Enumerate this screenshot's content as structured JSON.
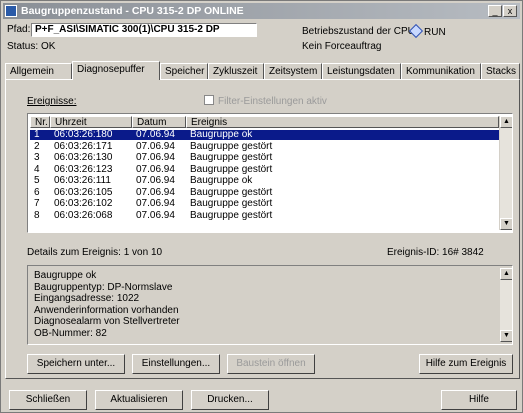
{
  "window": {
    "title": "Baugruppenzustand - CPU 315-2 DP  ONLINE",
    "min": "_",
    "close": "x"
  },
  "info": {
    "path_label": "Pfad:",
    "path_value": "P+F_ASI\\SIMATIC 300(1)\\CPU 315-2 DP",
    "status_label": "Status:",
    "status_value": "OK",
    "cpu_state_label": "Betriebszustand der CPU:",
    "cpu_state_value": "RUN",
    "force_status": "Kein Forceauftrag"
  },
  "tabs": [
    "Allgemein",
    "Diagnosepuffer",
    "Speicher",
    "Zykluszeit",
    "Zeitsystem",
    "Leistungsdaten",
    "Kommunikation",
    "Stacks"
  ],
  "events": {
    "label": "Ereignisse:",
    "filter_label": "Filter-Einstellungen aktiv",
    "columns": [
      "Nr.",
      "Uhrzeit",
      "Datum",
      "Ereignis"
    ],
    "rows": [
      {
        "nr": "1",
        "time": "06:03:26:180",
        "date": "07.06.94",
        "event": "Baugruppe ok"
      },
      {
        "nr": "2",
        "time": "06:03:26:171",
        "date": "07.06.94",
        "event": "Baugruppe gestört"
      },
      {
        "nr": "3",
        "time": "06:03:26:130",
        "date": "07.06.94",
        "event": "Baugruppe gestört"
      },
      {
        "nr": "4",
        "time": "06:03:26:123",
        "date": "07.06.94",
        "event": "Baugruppe gestört"
      },
      {
        "nr": "5",
        "time": "06:03:26:111",
        "date": "07.06.94",
        "event": "Baugruppe ok"
      },
      {
        "nr": "6",
        "time": "06:03:26:105",
        "date": "07.06.94",
        "event": "Baugruppe gestört"
      },
      {
        "nr": "7",
        "time": "06:03:26:102",
        "date": "07.06.94",
        "event": "Baugruppe gestört"
      },
      {
        "nr": "8",
        "time": "06:03:26:068",
        "date": "07.06.94",
        "event": "Baugruppe gestört"
      }
    ]
  },
  "details": {
    "label": "Details zum Ereignis:  1 von 10",
    "event_id_label": "Ereignis-ID:  16# 3842",
    "lines": [
      "Baugruppe ok",
      "Baugruppentyp: DP-Normslave",
      "Eingangsadresse:  1022",
      "Anwenderinformation vorhanden",
      "Diagnosealarm von Stellvertreter",
      "OB-Nummer:  82"
    ]
  },
  "panel_buttons": {
    "save": "Speichern unter...",
    "settings": "Einstellungen...",
    "open_block": "Baustein öffnen",
    "help_event": "Hilfe zum Ereignis"
  },
  "footer_buttons": {
    "close": "Schließen",
    "update": "Aktualisieren",
    "print": "Drucken...",
    "help": "Hilfe"
  }
}
